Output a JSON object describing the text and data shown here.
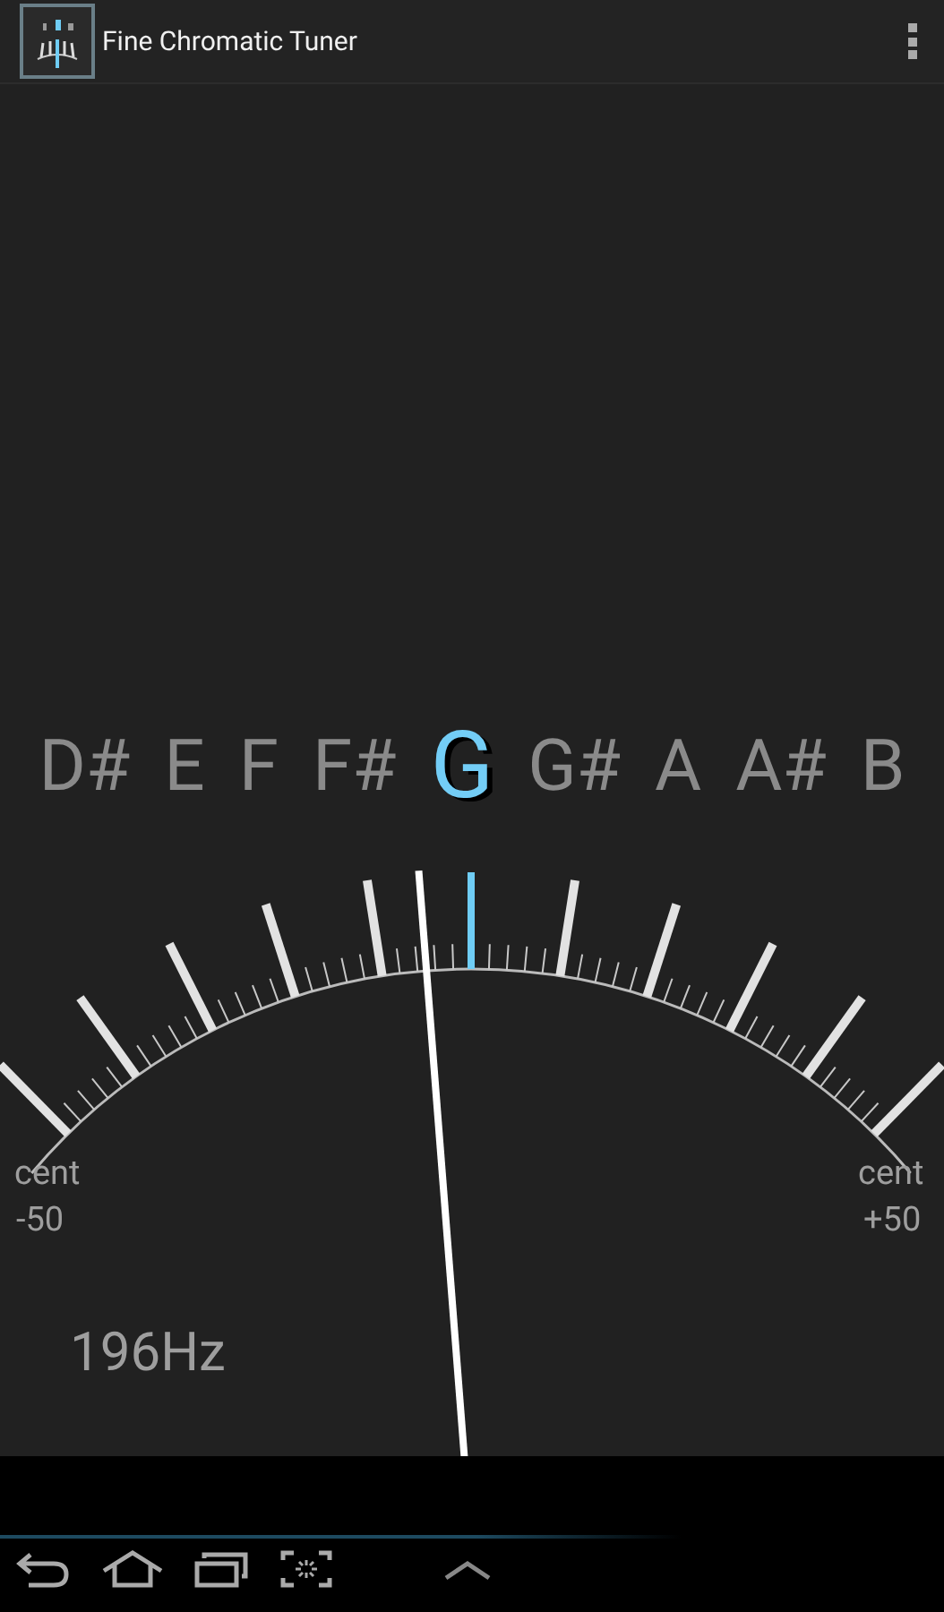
{
  "app_bar": {
    "title": "Fine Chromatic Tuner"
  },
  "notes": [
    {
      "label": "D#",
      "selected": false
    },
    {
      "label": "E",
      "selected": false
    },
    {
      "label": "F",
      "selected": false
    },
    {
      "label": "F#",
      "selected": false
    },
    {
      "label": "G",
      "selected": true
    },
    {
      "label": "G#",
      "selected": false
    },
    {
      "label": "A",
      "selected": false
    },
    {
      "label": "A#",
      "selected": false
    },
    {
      "label": "B",
      "selected": false
    }
  ],
  "meter": {
    "left_label": "cent",
    "left_value": "-50",
    "right_label": "cent",
    "right_value": "+50"
  },
  "frequency": "196Hz"
}
